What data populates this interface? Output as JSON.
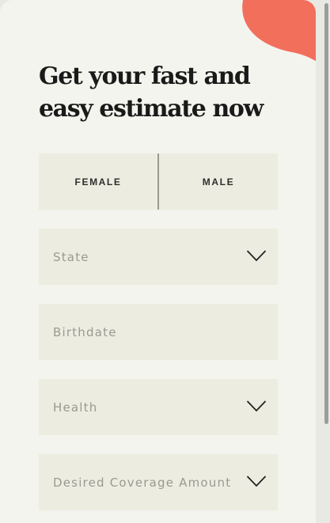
{
  "form": {
    "title_line1": "Get your fast and",
    "title_line2": "easy estimate now",
    "gender": {
      "female_label": "FEMALE",
      "male_label": "MALE"
    },
    "state": {
      "placeholder": "State",
      "icon": "chevron-down-icon"
    },
    "birthdate": {
      "placeholder": "Birthdate"
    },
    "health": {
      "placeholder": "Health",
      "icon": "chevron-down-icon"
    },
    "coverage": {
      "placeholder": "Desired Coverage Amount",
      "icon": "chevron-down-icon"
    }
  },
  "colors": {
    "accent_blob": "#f26f5c",
    "card_background": "#f4f4ee",
    "field_background": "#ecece0",
    "placeholder_text": "#9a9a92",
    "title_text": "#1a1a1a"
  }
}
